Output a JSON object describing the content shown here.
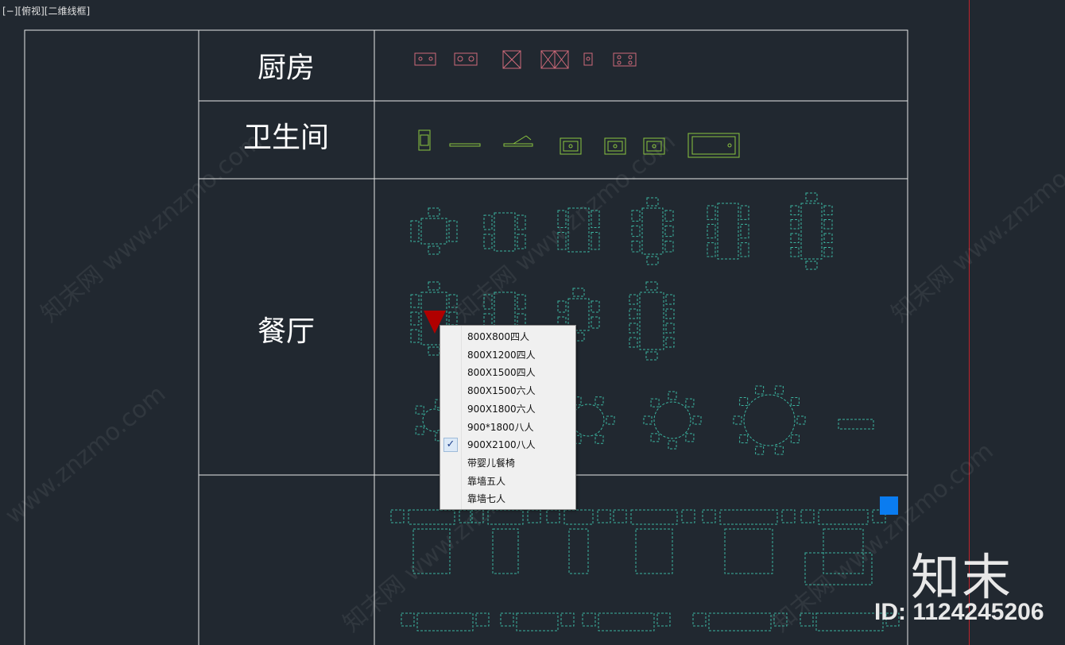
{
  "viewport_label": "[−][俯视][二维线框]",
  "table": {
    "rows": [
      {
        "label": "厨房"
      },
      {
        "label": "卫生间"
      },
      {
        "label": "餐厅"
      },
      {
        "label": ""
      }
    ]
  },
  "context_menu": {
    "items": [
      {
        "label": "800X800四人",
        "checked": false
      },
      {
        "label": "800X1200四人",
        "checked": false
      },
      {
        "label": "800X1500四人",
        "checked": false
      },
      {
        "label": "800X1500六人",
        "checked": false
      },
      {
        "label": "900X1800六人",
        "checked": false
      },
      {
        "label": "900*1800八人",
        "checked": false
      },
      {
        "label": "900X2100八人",
        "checked": true
      },
      {
        "label": "带婴儿餐椅",
        "checked": false
      },
      {
        "label": "靠墙五人",
        "checked": false
      },
      {
        "label": "靠墙七人",
        "checked": false
      }
    ],
    "check_glyph": "✓"
  },
  "watermark": {
    "brand": "知末",
    "id": "ID: 1124245206",
    "site": "www.znzmo.com",
    "site_cn": "知末网"
  },
  "colors": {
    "background": "#212830",
    "boundary": "#c0232b",
    "grip": "#0a7cf0",
    "kitchen_blocks": "#d06a7a",
    "bath_blocks": "#8cc63f",
    "dining_blocks": "#3bb5a0",
    "marker": "#b00000"
  }
}
